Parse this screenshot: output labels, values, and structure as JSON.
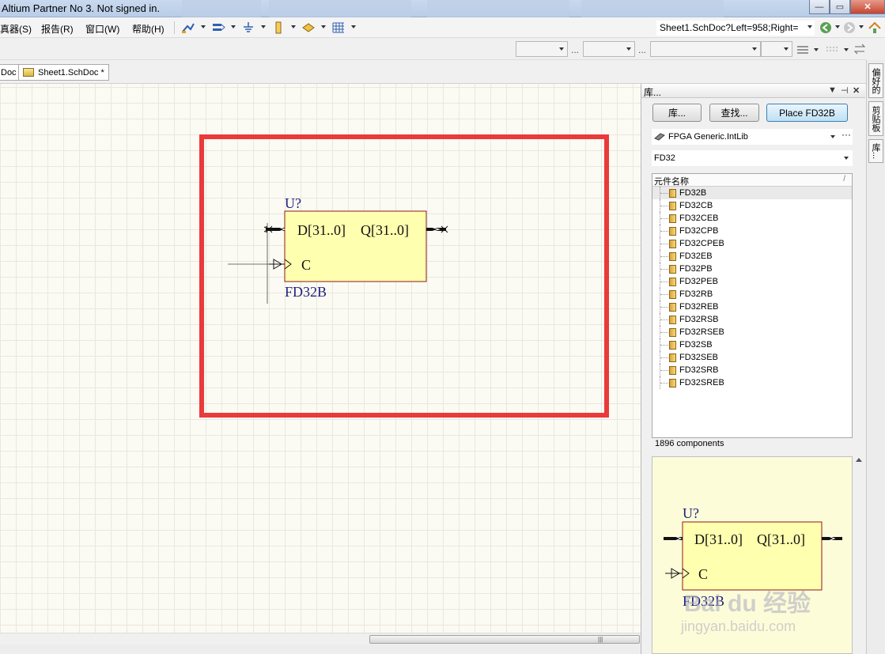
{
  "window": {
    "title": "Altium Partner No 3. Not signed in.",
    "minimize_glyph": "—",
    "maximize_glyph": "▭",
    "close_glyph": "✕"
  },
  "menu": {
    "items": [
      "真器(S)",
      "报告(R)",
      "窗口(W)",
      "帮助(H)"
    ]
  },
  "address": {
    "value": "Sheet1.SchDoc?Left=958;Right="
  },
  "tabs": {
    "partial_label": "Doc",
    "active_label": "Sheet1.SchDoc *"
  },
  "canvas": {
    "component": {
      "designator": "U?",
      "pin_d": "D[31..0]",
      "pin_q": "Q[31..0]",
      "pin_c": "C",
      "name": "FD32B"
    }
  },
  "panel": {
    "title": "库...",
    "buttons": {
      "libraries": "库...",
      "search": "查找...",
      "place": "Place FD32B"
    },
    "library_select": "FPGA Generic.IntLib",
    "filter_value": "FD32",
    "list_header": "元件名称",
    "list_header_sort": "/",
    "components": [
      "FD32B",
      "FD32CB",
      "FD32CEB",
      "FD32CPB",
      "FD32CPEB",
      "FD32EB",
      "FD32PB",
      "FD32PEB",
      "FD32RB",
      "FD32REB",
      "FD32RSB",
      "FD32RSEB",
      "FD32SB",
      "FD32SEB",
      "FD32SRB",
      "FD32SREB"
    ],
    "selected_component": "FD32B",
    "count_label": "1896 components",
    "preview": {
      "designator": "U?",
      "pin_d": "D[31..0]",
      "pin_q": "Q[31..0]",
      "pin_c": "C",
      "name": "FD32B"
    }
  },
  "sidetabs": [
    "偏好的",
    "剪贴板",
    "库..."
  ],
  "watermark": {
    "brand": "Bai du 经验",
    "url": "jingyan.baidu.com"
  },
  "colors": {
    "highlight_frame": "#ea3a3a",
    "component_fill": "#ffffb0",
    "component_border": "#8b1a1a",
    "schematic_text": "#202080"
  }
}
